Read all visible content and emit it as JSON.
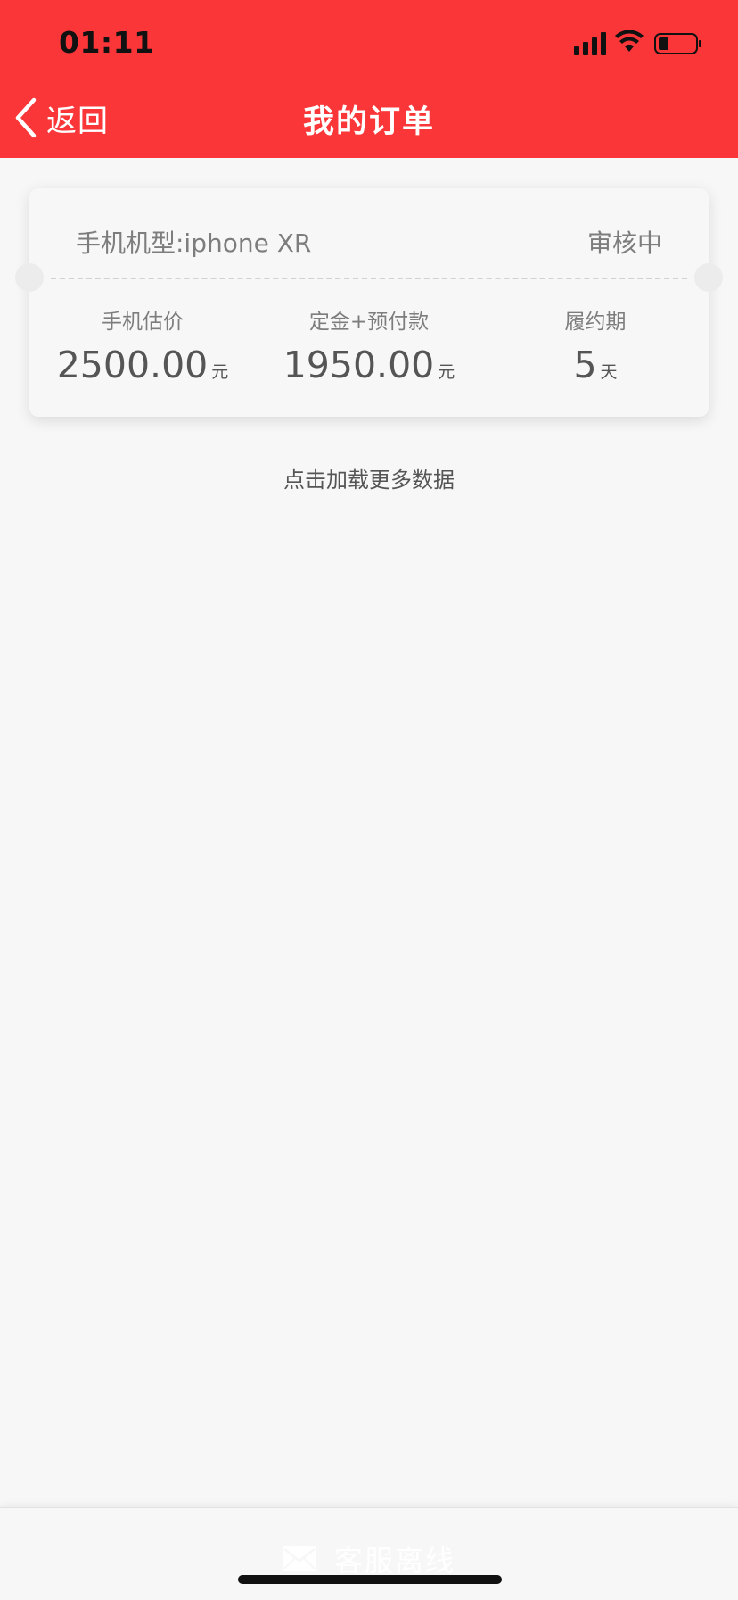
{
  "status_bar": {
    "time": "01:11",
    "icons": [
      "signal-icon",
      "wifi-icon",
      "battery-icon"
    ]
  },
  "nav": {
    "back_label": "返回",
    "title": "我的订单"
  },
  "order": {
    "model_text": "手机机型:iphone XR",
    "status": "审核中",
    "stats": [
      {
        "label": "手机估价",
        "value": "2500.00",
        "unit": "元"
      },
      {
        "label": "定金+预付款",
        "value": "1950.00",
        "unit": "元"
      },
      {
        "label": "履约期",
        "value": "5",
        "unit": "天"
      }
    ]
  },
  "load_more": "点击加载更多数据",
  "bottom_bar": {
    "icon": "mail-icon",
    "label": "客服离线"
  },
  "colors": {
    "header_bg": "#fb3639",
    "page_bg": "#f7f7f7",
    "muted_text": "#7d7d7d",
    "value_text": "#555555"
  }
}
